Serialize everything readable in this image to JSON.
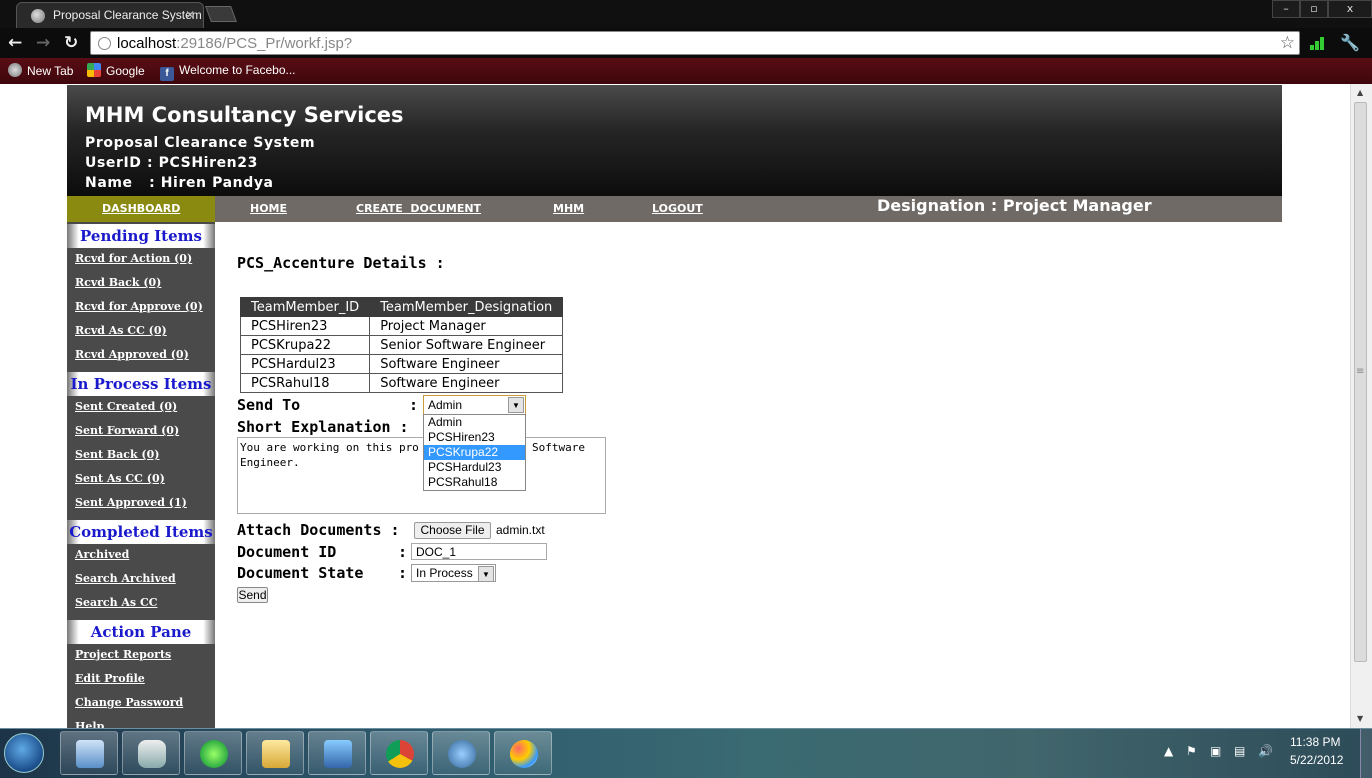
{
  "browser": {
    "tab_title": "Proposal Clearance System",
    "url_host": "localhost",
    "url_rest": ":29186/PCS_Pr/workf.jsp?",
    "window_buttons": [
      "–",
      "▫",
      "x"
    ],
    "bookmarks": [
      {
        "label": "New Tab",
        "icon": "new-tab-icon"
      },
      {
        "label": "Google",
        "icon": "google-icon"
      },
      {
        "label": "Welcome to Facebo...",
        "icon": "facebook-icon"
      }
    ]
  },
  "header": {
    "company": "MHM Consultancy Services",
    "system": "Proposal Clearance System",
    "userid": "UserID : PCSHiren23",
    "name": "Name   : Hiren Pandya"
  },
  "nav": {
    "dashboard": "DASHBOARD",
    "home": "HOME",
    "create_document": "CREATE  DOCUMENT",
    "mhm": "MHM",
    "logout": "LOGOUT",
    "designation": "Designation : Project Manager"
  },
  "sidebar": {
    "pending_title": "Pending Items",
    "pending": [
      "Rcvd for Action (0)",
      "Rcvd Back (0)",
      "Rcvd for Approve (0)",
      "Rcvd As CC (0)",
      "Rcvd Approved (0)"
    ],
    "process_title": "In Process Items",
    "process": [
      "Sent Created (0)",
      "Sent Forward (0)",
      "Sent Back (0)",
      "Sent As CC (0)",
      "Sent Approved (1)"
    ],
    "completed_title": "Completed Items",
    "completed": [
      "Archived",
      "Search Archived",
      "Search As CC"
    ],
    "action_title": "Action Pane",
    "action": [
      "Project Reports",
      "Edit Profile",
      "Change Password",
      "Help"
    ]
  },
  "main": {
    "details_title": "PCS_Accenture Details :",
    "team_headers": [
      "TeamMember_ID",
      "TeamMember_Designation"
    ],
    "team_rows": [
      [
        "PCSHiren23",
        "Project Manager"
      ],
      [
        "PCSKrupa22",
        "Senior Software Engineer"
      ],
      [
        "PCSHardul23",
        "Software Engineer"
      ],
      [
        "PCSRahul18",
        "Software Engineer"
      ]
    ],
    "send_to_label": "Send To",
    "send_to_value": "Admin",
    "send_to_options": [
      "Admin",
      "PCSHiren23",
      "PCSKrupa22",
      "PCSHardul23",
      "PCSRahul18"
    ],
    "send_to_highlighted": "PCSKrupa22",
    "short_expl_label": "Short Explanation :",
    "short_expl_visible_1": "You are working on this pro",
    "short_expl_visible_2": "Software",
    "short_expl_line2": "Engineer.",
    "attach_label": "Attach Documents :",
    "choose_file": "Choose File",
    "file_name": "admin.txt",
    "docid_label": "Document ID",
    "docid_value": "DOC_1",
    "docstate_label": "Document State",
    "docstate_value": "In Process",
    "send_button": "Send",
    "colon": ":"
  },
  "taskbar": {
    "time": "11:38 PM",
    "date": "5/22/2012",
    "pinned": [
      "virtualbox-icon",
      "outlook-icon",
      "ie-icon",
      "explorer-icon",
      "image-viewer-icon",
      "chrome-icon",
      "dolphin-icon",
      "paint-icon"
    ]
  }
}
